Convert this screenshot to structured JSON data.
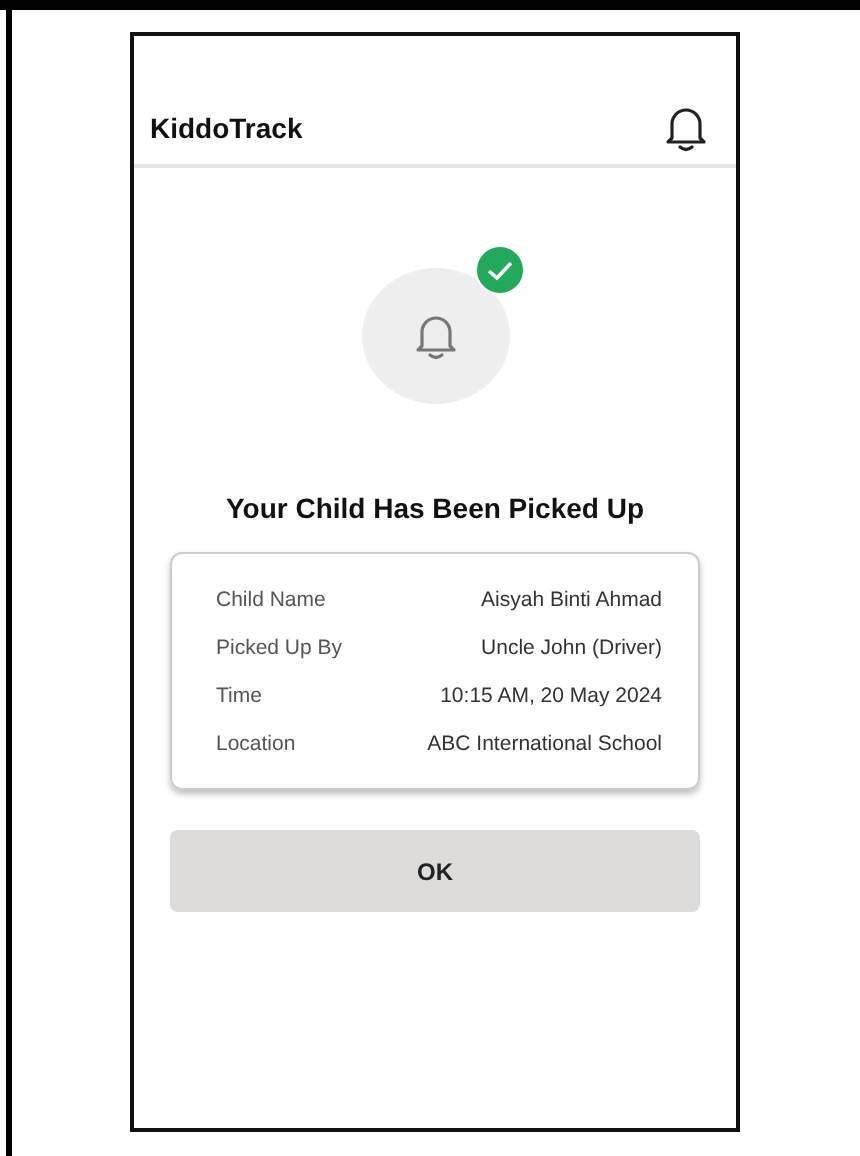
{
  "app_bar": {
    "title": "KiddoTrack"
  },
  "status": {
    "confirmed": true
  },
  "heading": "Your Child Has Been Picked Up",
  "details": [
    {
      "label": "Child Name",
      "value": "Aisyah Binti Ahmad"
    },
    {
      "label": "Picked Up By",
      "value": "Uncle John (Driver)"
    },
    {
      "label": "Time",
      "value": "10:15 AM, 20 May 2024"
    },
    {
      "label": "Location",
      "value": "ABC International School"
    }
  ],
  "buttons": [
    "OK"
  ]
}
